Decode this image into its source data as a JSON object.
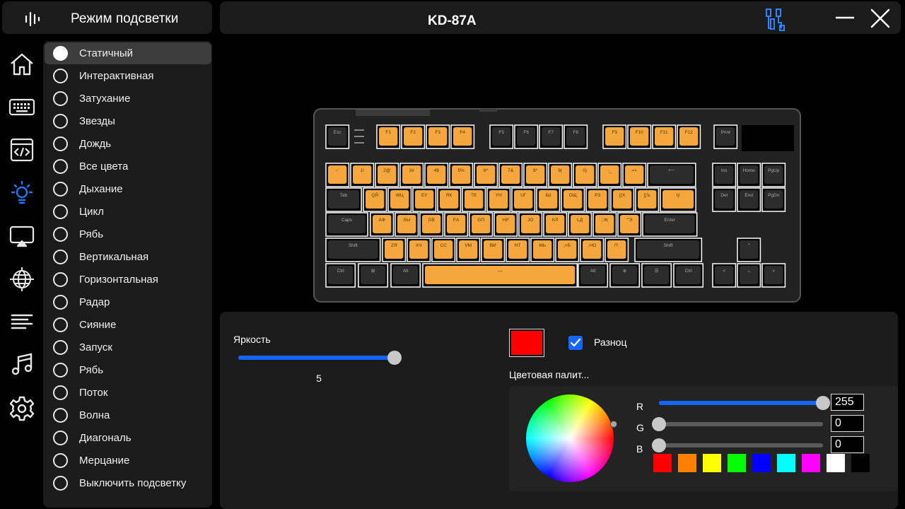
{
  "sidebar": {
    "title": "Режим подсветки",
    "logo_icon": "equalizer-logo-icon",
    "rail": [
      {
        "icon": "home-icon"
      },
      {
        "icon": "keyboard-icon"
      },
      {
        "icon": "macro-code-icon"
      },
      {
        "icon": "lighting-icon",
        "active": true
      },
      {
        "icon": "screen-sync-icon"
      },
      {
        "icon": "network-globe-icon"
      },
      {
        "icon": "text-lines-icon"
      },
      {
        "icon": "music-icon"
      },
      {
        "icon": "settings-gear-icon"
      }
    ]
  },
  "modes": [
    "Статичный",
    "Интерактивная",
    "Затухание",
    "Звезды",
    "Дождь",
    "Все цвета",
    "Дыхание",
    "Цикл",
    "Рябь",
    "Вертикальная",
    "Горизонтальная",
    "Радар",
    "Сияние",
    "Запуск",
    "Рябь",
    "Поток",
    "Волна",
    "Диагональ",
    "Мерцание",
    "Выключить подсветку"
  ],
  "selected_mode_index": 0,
  "header": {
    "device_name": "KD-87A",
    "connection_icon": "usb-connection-icon",
    "minimize_icon": "minimize-icon",
    "close_icon": "close-icon"
  },
  "keyboard": {
    "rows": [
      [
        "Esc",
        "",
        "F1",
        "F2",
        "F3",
        "F4",
        "F5",
        "F6",
        "F7",
        "F8",
        "F9",
        "F10",
        "F11",
        "F12",
        "Print"
      ],
      [
        "~`",
        "1!",
        "2@",
        "3#",
        "4$",
        "5%",
        "6^",
        "7&",
        "8*",
        "9(",
        "0)",
        "-_",
        "=+",
        "⟵",
        "Ins",
        "Home",
        "PgUp"
      ],
      [
        "Tab",
        "QЙ",
        "WЦ",
        "EУ",
        "RК",
        "TЕ",
        "YН",
        "UГ",
        "IШ",
        "OЩ",
        "PЗ",
        "[{Х",
        "]}Ъ",
        "\\|/",
        "Del",
        "End",
        "PgDn"
      ],
      [
        "Caps",
        "AФ",
        "SЫ",
        "DВ",
        "FА",
        "GП",
        "HР",
        "JО",
        "KЛ",
        "LД",
        ";:Ж",
        "'\"Э",
        "Enter"
      ],
      [
        "Shift",
        "ZЯ",
        "XЧ",
        "CС",
        "VМ",
        "BИ",
        "NТ",
        "MЬ",
        ",<Б",
        ".>Ю",
        "/?.",
        "Shift",
        "⌃"
      ],
      [
        "Ctrl",
        "⊞",
        "Alt",
        "—",
        "Alt",
        "⊕",
        "☰",
        "Ctrl",
        "<",
        "⌄",
        ">"
      ]
    ],
    "lit_color": "#f5a63c",
    "dark_color": "#2c2c2c"
  },
  "brightness": {
    "label": "Яркость",
    "value": "5",
    "level": 1.0
  },
  "color": {
    "current": "#ff0000",
    "random_label": "Разноц",
    "random_checked": true,
    "palette_label": "Цветовая палит...",
    "r_label": "R",
    "g_label": "G",
    "b_label": "B",
    "r": "255",
    "g": "0",
    "b": "0",
    "presets": [
      "#ff0000",
      "#ff8000",
      "#ffff00",
      "#00ff00",
      "#0000ff",
      "#00ffff",
      "#ff00ff",
      "#ffffff",
      "#000000"
    ]
  }
}
